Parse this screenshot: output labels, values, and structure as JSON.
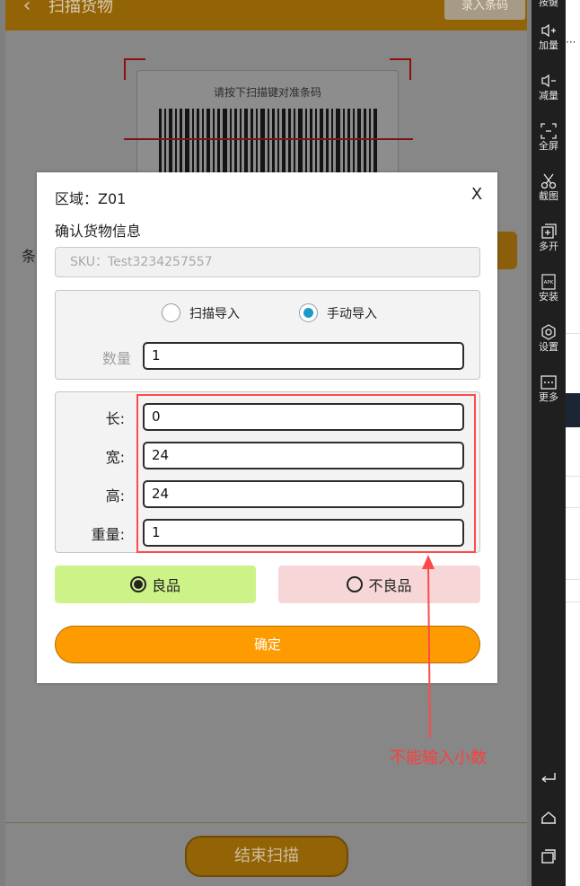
{
  "app": {
    "title": "扫描货物",
    "enter_code_label": "录入条码",
    "scan_hint": "请按下扫描键对准条码",
    "background_label": "条",
    "end_scan_label": "结束扫描"
  },
  "dialog": {
    "zone_label": "区域：Z01",
    "close_label": "X",
    "section_title": "确认货物信息",
    "sku_text": "SKU：Test3234257557",
    "import_options": [
      {
        "label": "扫描导入",
        "selected": false
      },
      {
        "label": "手动导入",
        "selected": true
      }
    ],
    "quantity_label": "数量",
    "quantity_value": "1",
    "dimensions": [
      {
        "label": "长:",
        "value": "0"
      },
      {
        "label": "宽:",
        "value": "24"
      },
      {
        "label": "高:",
        "value": "24"
      },
      {
        "label": "重量:",
        "value": "1"
      }
    ],
    "good_label": "良品",
    "bad_label": "不良品",
    "good_selected": true,
    "confirm_label": "确定"
  },
  "toolbar": {
    "top_label": "按键",
    "items": [
      {
        "label": "加量",
        "icon": "volume-up-icon"
      },
      {
        "label": "减量",
        "icon": "volume-down-icon"
      },
      {
        "label": "全屏",
        "icon": "fullscreen-icon"
      },
      {
        "label": "截图",
        "icon": "scissors-icon"
      },
      {
        "label": "多开",
        "icon": "multi-open-icon"
      },
      {
        "label": "安装",
        "icon": "apk-install-icon"
      },
      {
        "label": "设置",
        "icon": "settings-icon"
      },
      {
        "label": "更多",
        "icon": "more-icon"
      }
    ],
    "apk_glyph": "APK",
    "nav": [
      "back-icon",
      "home-icon",
      "recent-apps-icon"
    ]
  },
  "strip": {
    "dots": "···"
  },
  "annotation": {
    "text": "不能输入小数",
    "color": "#ff3d3d"
  },
  "colors": {
    "accent_orange": "#fd9b00",
    "good_green": "#cdf388",
    "bad_pink": "#f6d6d6",
    "radio_blue": "#1e9ac9"
  }
}
